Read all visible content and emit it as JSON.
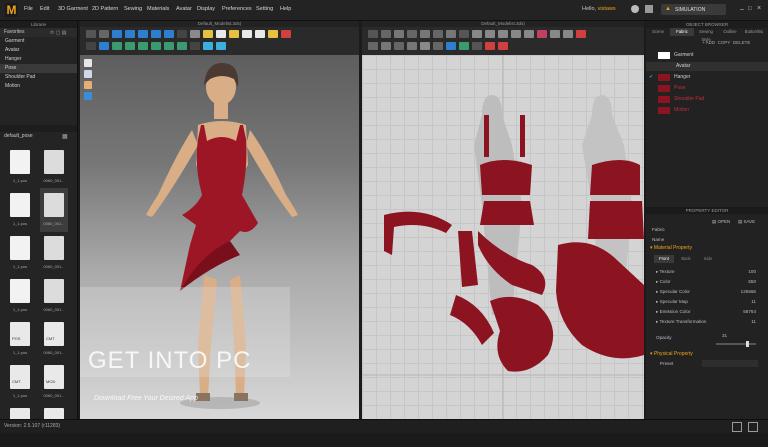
{
  "app": {
    "logo": "M"
  },
  "menu": [
    "File",
    "Edit",
    "3D Garment",
    "2D Pattern",
    "Sewing",
    "Materials",
    "Avatar",
    "Display",
    "Preferences",
    "Setting",
    "Help"
  ],
  "user": {
    "greeting": "Hello,",
    "name": "vistaws",
    "mode": "SIMULATION"
  },
  "left_panel": {
    "library_title": "Librarie",
    "favorites_label": "Favorites",
    "favorites": [
      "Garment",
      "Avatar",
      "Hanger",
      "Pose",
      "Shoulder Pad",
      "Motion"
    ],
    "selected": "Pose",
    "folder_label": "default_pose",
    "thumbs": [
      {
        "label": "1_1.pos",
        "kind": "pose"
      },
      {
        "label": "0060_001...",
        "kind": "face"
      },
      {
        "label": "1_1.pos",
        "kind": "pose"
      },
      {
        "label": "0060_001...",
        "kind": "face"
      },
      {
        "label": "1_1.pos",
        "kind": "pose"
      },
      {
        "label": "0060_001...",
        "kind": "face"
      },
      {
        "label": "1_1.pos",
        "kind": "pose"
      },
      {
        "label": "0060_001...",
        "kind": "face"
      },
      {
        "label": "1_1.pos",
        "kind": "file",
        "tag": "POS"
      },
      {
        "label": "0060_001...",
        "kind": "file",
        "tag": "CMT"
      },
      {
        "label": "1_1.pos",
        "kind": "file",
        "tag": "CMT"
      },
      {
        "label": "0060_001...",
        "kind": "file",
        "tag": "MOD"
      },
      {
        "label": "",
        "kind": "file",
        "tag": ""
      },
      {
        "label": "",
        "kind": "file",
        "tag": ""
      }
    ]
  },
  "viewport3d": {
    "title": "Default_Modelist.3ds)"
  },
  "viewport2d": {
    "title": "Default_Modelist.3ds)"
  },
  "right_panel": {
    "title": "OBJECT BROWSER",
    "tabs": [
      "Scene",
      "Fabric",
      "Sewing Style",
      "Outline",
      "Button/Bu"
    ],
    "active_tab": "Fabric",
    "add_label": "+ ADD",
    "copy_label": "COPY",
    "delete_label": "DELETE",
    "objects": [
      {
        "label": "Garment",
        "color": "#ffffff",
        "checked": false
      },
      {
        "label": "Avatar",
        "color": "",
        "checked": false,
        "header": true
      },
      {
        "label": "Hanger",
        "color": "#8c1420",
        "checked": true
      },
      {
        "label": "Pose",
        "color": "#8c1420",
        "checked": false
      },
      {
        "label": "Shoulder Pad",
        "color": "#8c1420",
        "checked": false
      },
      {
        "label": "Motion",
        "color": "#8c1420",
        "checked": false
      }
    ],
    "editor_title": "PROPERTY EDITOR",
    "open_label": "OPEN",
    "save_label": "SAVE",
    "fields": [
      {
        "k": "Fabric",
        "v": ""
      },
      {
        "k": "Name",
        "v": ""
      }
    ],
    "material_header": "Material Property",
    "material_tabs": [
      "Front",
      "Back",
      "Side"
    ],
    "material_rows": [
      {
        "k": "Texture",
        "v": "100"
      },
      {
        "k": "Color",
        "v": "550"
      },
      {
        "k": "Specular Color",
        "v": "125566"
      },
      {
        "k": "Specular Map",
        "v": "11"
      },
      {
        "k": "Emission Color",
        "v": "58764"
      },
      {
        "k": "Texture Transformation",
        "v": "11"
      }
    ],
    "opacity_label": "Opacity",
    "opacity_value": "31",
    "physical_header": "Physical Property",
    "preset_label": "Preset"
  },
  "watermark": {
    "title": "GET INTO PC",
    "tagline": "Download Free Your Desired App"
  },
  "status": {
    "version": "Version: 2.5.107 (r11283)"
  },
  "colors": {
    "accent": "#f0a21b",
    "fabric": "#8c1420"
  }
}
